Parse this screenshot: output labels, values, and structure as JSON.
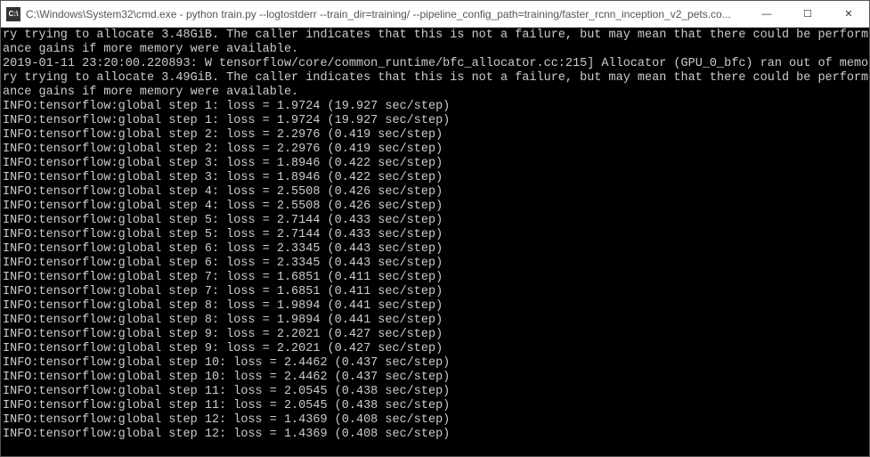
{
  "window": {
    "icon": "C:\\",
    "title": "C:\\Windows\\System32\\cmd.exe - python  train.py --logtostderr --train_dir=training/ --pipeline_config_path=training/faster_rcnn_inception_v2_pets.co...",
    "minimize": "—",
    "maximize": "☐",
    "close": "✕"
  },
  "terminal": {
    "lines": [
      "ry trying to allocate 3.48GiB. The caller indicates that this is not a failure, but may mean that there could be perform",
      "ance gains if more memory were available.",
      "2019-01-11 23:20:00.220893: W tensorflow/core/common_runtime/bfc_allocator.cc:215] Allocator (GPU_0_bfc) ran out of memo",
      "ry trying to allocate 3.49GiB. The caller indicates that this is not a failure, but may mean that there could be perform",
      "ance gains if more memory were available.",
      "INFO:tensorflow:global step 1: loss = 1.9724 (19.927 sec/step)",
      "INFO:tensorflow:global step 1: loss = 1.9724 (19.927 sec/step)",
      "INFO:tensorflow:global step 2: loss = 2.2976 (0.419 sec/step)",
      "INFO:tensorflow:global step 2: loss = 2.2976 (0.419 sec/step)",
      "INFO:tensorflow:global step 3: loss = 1.8946 (0.422 sec/step)",
      "INFO:tensorflow:global step 3: loss = 1.8946 (0.422 sec/step)",
      "INFO:tensorflow:global step 4: loss = 2.5508 (0.426 sec/step)",
      "INFO:tensorflow:global step 4: loss = 2.5508 (0.426 sec/step)",
      "INFO:tensorflow:global step 5: loss = 2.7144 (0.433 sec/step)",
      "INFO:tensorflow:global step 5: loss = 2.7144 (0.433 sec/step)",
      "INFO:tensorflow:global step 6: loss = 2.3345 (0.443 sec/step)",
      "INFO:tensorflow:global step 6: loss = 2.3345 (0.443 sec/step)",
      "INFO:tensorflow:global step 7: loss = 1.6851 (0.411 sec/step)",
      "INFO:tensorflow:global step 7: loss = 1.6851 (0.411 sec/step)",
      "INFO:tensorflow:global step 8: loss = 1.9894 (0.441 sec/step)",
      "INFO:tensorflow:global step 8: loss = 1.9894 (0.441 sec/step)",
      "INFO:tensorflow:global step 9: loss = 2.2021 (0.427 sec/step)",
      "INFO:tensorflow:global step 9: loss = 2.2021 (0.427 sec/step)",
      "INFO:tensorflow:global step 10: loss = 2.4462 (0.437 sec/step)",
      "INFO:tensorflow:global step 10: loss = 2.4462 (0.437 sec/step)",
      "INFO:tensorflow:global step 11: loss = 2.0545 (0.438 sec/step)",
      "INFO:tensorflow:global step 11: loss = 2.0545 (0.438 sec/step)",
      "INFO:tensorflow:global step 12: loss = 1.4369 (0.408 sec/step)",
      "INFO:tensorflow:global step 12: loss = 1.4369 (0.408 sec/step)"
    ]
  }
}
